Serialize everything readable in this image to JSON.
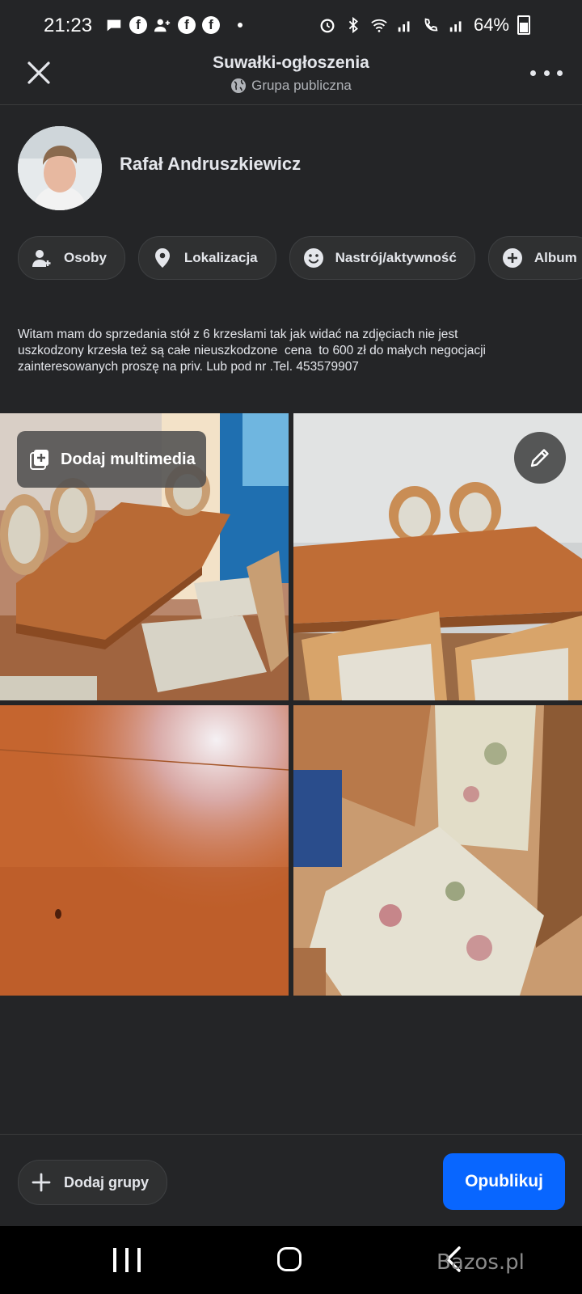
{
  "status_bar": {
    "time": "21:23",
    "battery": "64%",
    "notification_icons": [
      "chat-icon",
      "facebook-icon",
      "person-add-icon",
      "facebook-icon",
      "facebook-icon"
    ],
    "system_icons": [
      "alarm-icon",
      "bluetooth-icon",
      "wifi-icon",
      "signal-icon",
      "wifi-call-icon",
      "signal-icon"
    ]
  },
  "header": {
    "title": "Suwałki-ogłoszenia",
    "subtitle": "Grupa publiczna"
  },
  "author": {
    "name": "Rafał Andruszkiewicz"
  },
  "chips": [
    {
      "label": "Osoby",
      "icon": "people-tag-icon"
    },
    {
      "label": "Lokalizacja",
      "icon": "location-pin-icon"
    },
    {
      "label": "Nastrój/aktywność",
      "icon": "smiley-icon"
    },
    {
      "label": "Album",
      "icon": "plus-circle-icon"
    }
  ],
  "post": {
    "text": "Witam mam do sprzedania stół z 6 krzesłami tak jak widać na zdjęciach nie jest\nuszkodzony krzesła też są całe nieuszkodzone  cena  to 600 zł do małych negocjacji\nzainteresowanych proszę na priv. Lub pod nr .Tel. 453579907"
  },
  "media": {
    "add_label": "Dodaj multimedia"
  },
  "footer": {
    "add_groups_label": "Dodaj grupy",
    "publish_label": "Opublikuj"
  },
  "watermark": "Bazos.pl",
  "colors": {
    "background": "#242527",
    "accent": "#0866ff",
    "text": "#e4e6eb",
    "muted": "#b0b3b8"
  }
}
